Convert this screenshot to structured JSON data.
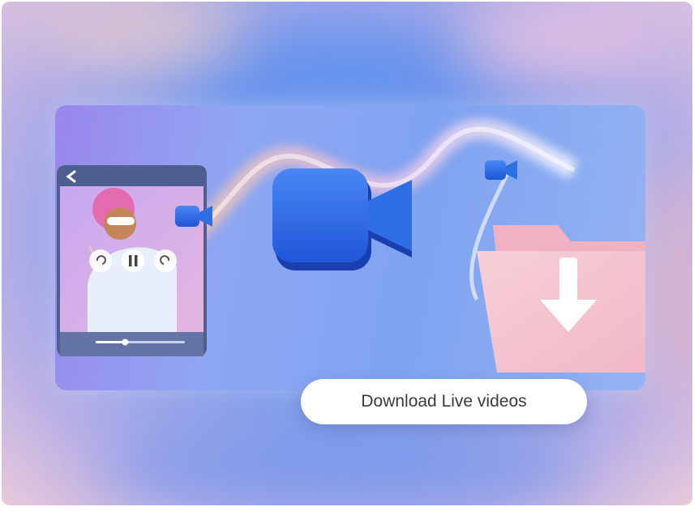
{
  "cta": {
    "label": "Download Live videos"
  },
  "phone": {
    "back_icon": "chevron-left-icon",
    "rewind_icon": "rewind-icon",
    "pause_icon": "pause-icon",
    "forward_icon": "forward-icon",
    "progress": 0.33
  },
  "icons": {
    "main": "video-camera-icon",
    "small_left": "video-camera-icon",
    "small_right": "video-camera-icon",
    "folder": "folder-download-icon"
  },
  "colors": {
    "camera_blue": "#2f6fe6",
    "folder_pink": "#f4c3cf",
    "pill_bg": "#ffffff",
    "pill_text": "#3a3a3a"
  }
}
